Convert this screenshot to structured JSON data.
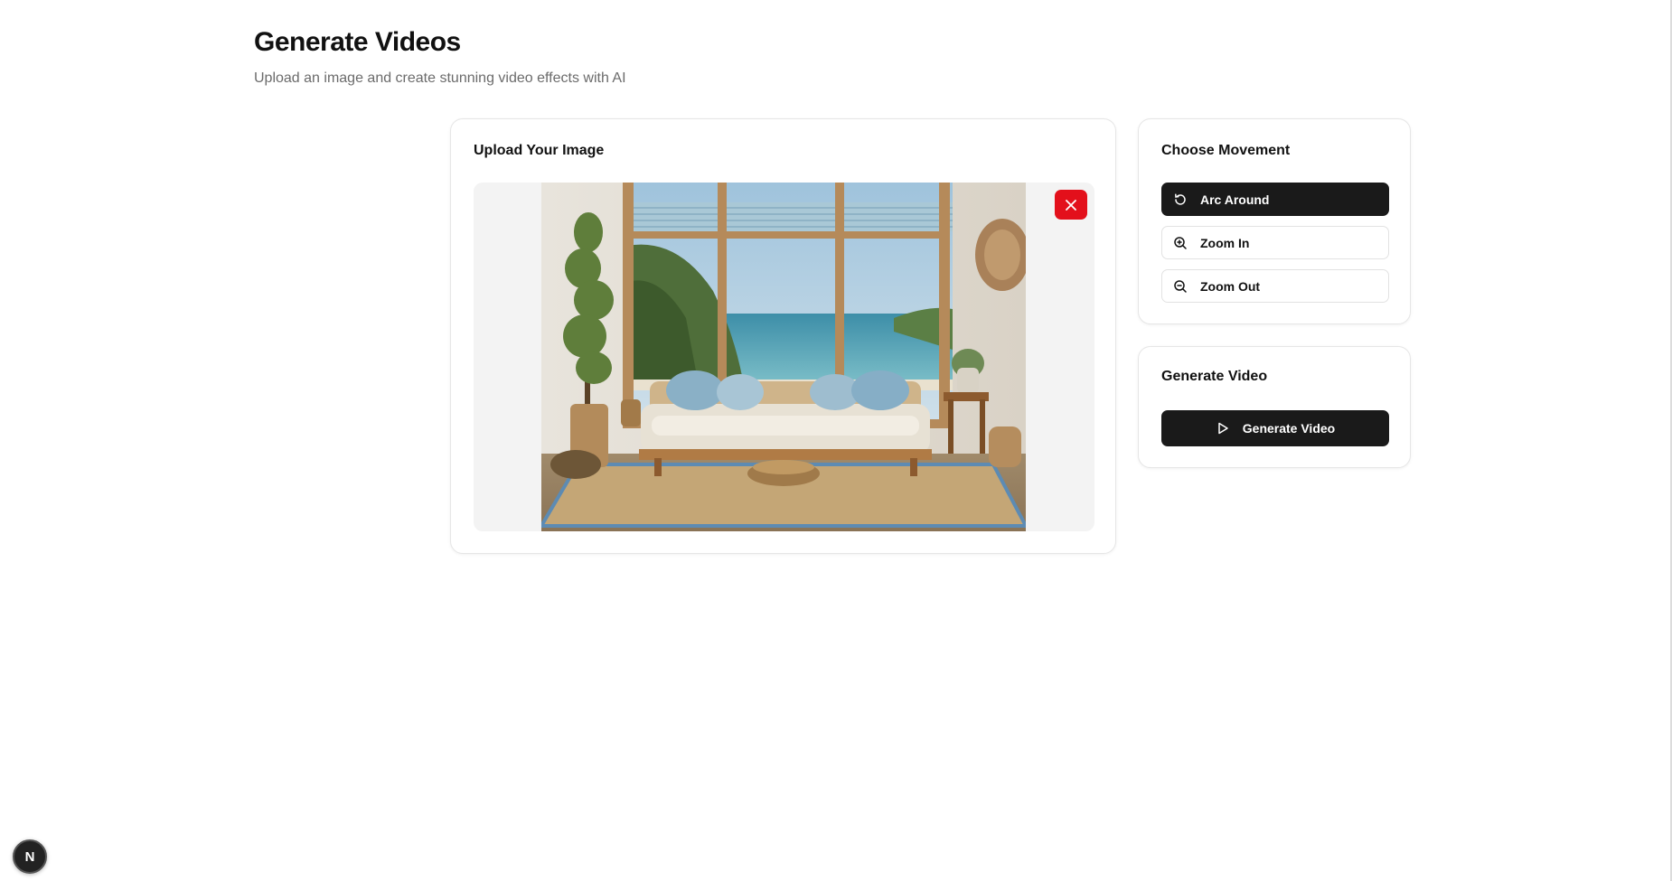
{
  "header": {
    "title": "Generate Videos",
    "subtitle": "Upload an image and create stunning video effects with AI"
  },
  "upload": {
    "title": "Upload Your Image",
    "remove_icon": "close-icon"
  },
  "movement": {
    "title": "Choose Movement",
    "options": [
      {
        "label": "Arc Around",
        "icon": "rotate-icon",
        "active": true
      },
      {
        "label": "Zoom In",
        "icon": "zoom-in-icon",
        "active": false
      },
      {
        "label": "Zoom Out",
        "icon": "zoom-out-icon",
        "active": false
      }
    ]
  },
  "generate": {
    "title": "Generate Video",
    "button_label": "Generate Video",
    "button_icon": "play-icon"
  },
  "badge": {
    "label": "N"
  },
  "colors": {
    "primary": "#1a1a1a",
    "danger": "#e3101b",
    "muted_text": "#6b6b6b"
  }
}
